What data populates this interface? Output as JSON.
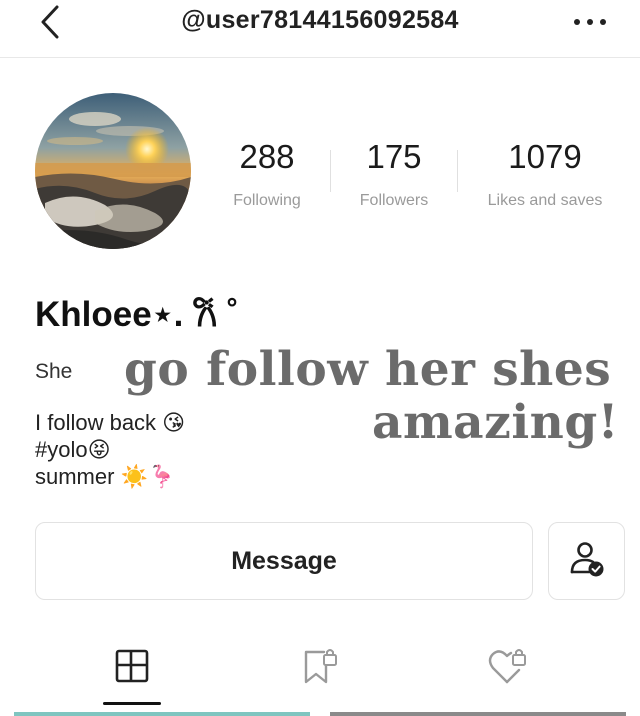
{
  "header": {
    "handle": "@user78144156092584",
    "back_icon": "chevron-left-icon",
    "more_icon": "more-dots-icon"
  },
  "profile": {
    "avatar": "sunset-beach-avatar",
    "name": "Khloee⋆. 𐙚 ˚",
    "stats": {
      "following": {
        "value": "288",
        "label": "Following"
      },
      "followers": {
        "value": "175",
        "label": "Followers"
      },
      "likes": {
        "value": "1079",
        "label": "Likes and saves"
      }
    },
    "bio": {
      "pronoun": "She",
      "line1": "I follow back 😘",
      "line2": "#yolo😝",
      "line3": "summer ☀️🦩"
    }
  },
  "overlay": {
    "line1": "go follow her shes",
    "line2": "amazing!"
  },
  "actions": {
    "message_label": "Message",
    "follow_state_icon": "user-check-icon"
  },
  "tabs": [
    {
      "icon": "grid-notes-icon",
      "active": true
    },
    {
      "icon": "bookmark-locked-icon",
      "active": false
    },
    {
      "icon": "heart-locked-icon",
      "active": false
    }
  ],
  "colors": {
    "text": "#111111",
    "muted": "#9a9a9a",
    "overlay_text": "#6b6b6b",
    "border": "#e2e2e2"
  }
}
